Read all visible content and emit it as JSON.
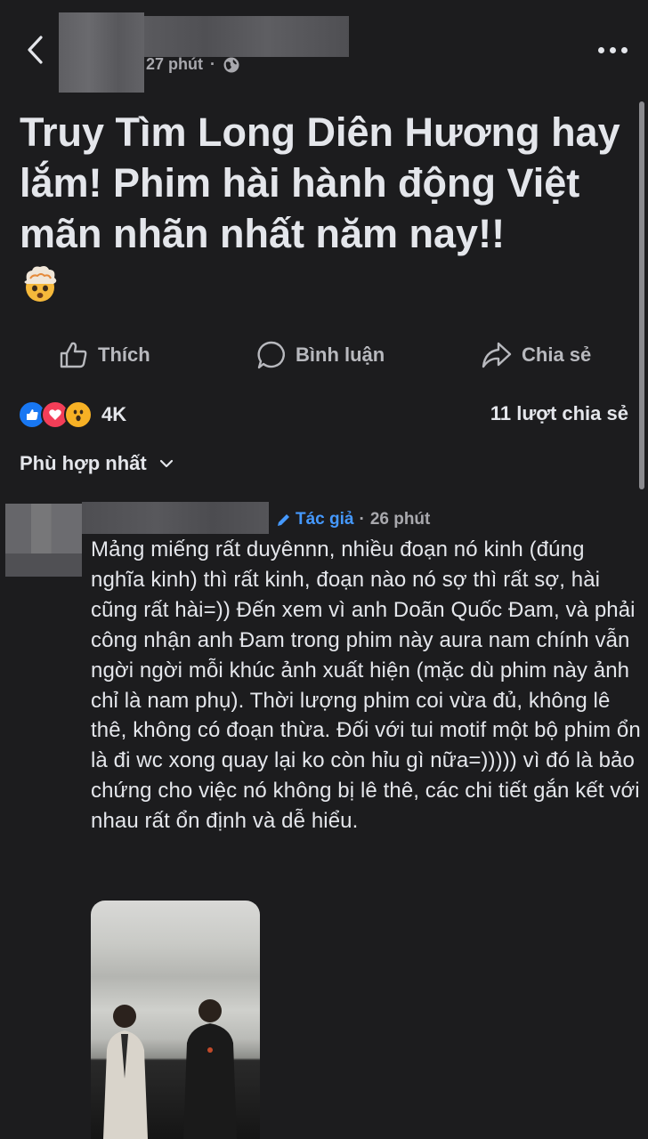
{
  "post": {
    "time": "27 phút",
    "privacy_icon": "globe-icon",
    "text": "Truy Tìm Long Diên Hương hay lắm! Phim hài hành động Việt mãn nhãn nhất năm nay!!"
  },
  "actions": {
    "like": "Thích",
    "comment": "Bình luận",
    "share": "Chia sẻ"
  },
  "stats": {
    "reactions_count": "4K",
    "shares": "11 lượt chia sẻ"
  },
  "sort": {
    "label": "Phù hợp nhất"
  },
  "comment": {
    "badge": "Tác giả",
    "separator": "·",
    "time": "26 phút",
    "text": "Mảng miếng rất duyênnn, nhiều đoạn nó kinh (đúng nghĩa kinh) thì rất kinh, đoạn nào nó sợ thì rất sợ, hài cũng rất hài=)) Đến xem vì anh Doãn Quốc Đam, và phải công nhận anh Đam trong phim này aura nam chính vẫn ngời ngời mỗi khúc ảnh xuất hiện (mặc dù phim này ảnh chỉ là nam phụ). Thời lượng phim coi vừa đủ, không lê thê, không có đoạn thừa. Đối với tui motif một bộ phim ổn là đi wc xong quay lại ko còn hỉu gì nữa=))))) vì đó là bảo chứng cho việc nó không bị lê thê, các chi tiết gắn kết với nhau rất ổn định và dễ hiểu."
  },
  "colors": {
    "background": "#1c1c1e",
    "text": "#e4e6eb",
    "muted": "#a8a8ad",
    "author_blue": "#4599ff",
    "like_blue": "#1877f2",
    "love_red": "#f33e58",
    "wow_yellow": "#f7b125"
  }
}
